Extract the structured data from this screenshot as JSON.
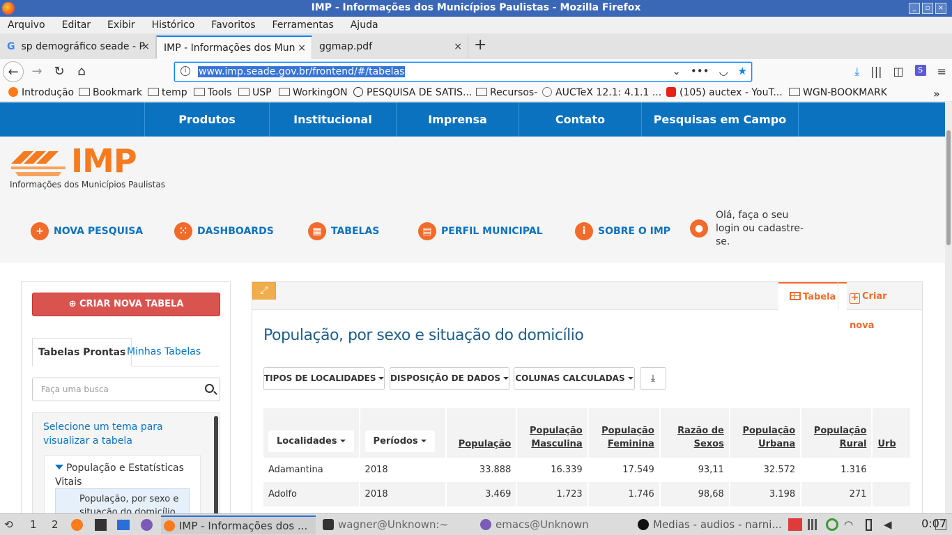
{
  "window": {
    "title": "IMP - Informações dos Municípios Paulistas - Mozilla Firefox",
    "controls": [
      "_",
      "▫",
      "×"
    ]
  },
  "menu": [
    "Arquivo",
    "Editar",
    "Exibir",
    "Histórico",
    "Favoritos",
    "Ferramentas",
    "Ajuda"
  ],
  "tabs": [
    {
      "label": "sp demográfico seade - P",
      "close": "×"
    },
    {
      "label": "IMP - Informações dos Munic",
      "close": "×"
    },
    {
      "label": "ggmap.pdf",
      "close": "×"
    }
  ],
  "newtab_label": "+",
  "nav": {
    "url": "www.imp.seade.gov.br/frontend/#/tabelas",
    "back": "←",
    "forward": "→",
    "reload": "↻",
    "home": "⌂",
    "url_icons": {
      "dropdown": "⌄",
      "more": "•••",
      "pocket": "◡",
      "star": "★"
    },
    "right_icons": {
      "download": "⤓",
      "library": "|||",
      "sidebar": "◫",
      "ext": "S",
      "menu": "≡"
    }
  },
  "bookmarks": [
    {
      "label": "Introdução",
      "type": "firefox"
    },
    {
      "label": "Bookmark",
      "type": "folder"
    },
    {
      "label": "temp",
      "type": "folder"
    },
    {
      "label": "Tools",
      "type": "folder"
    },
    {
      "label": "USP",
      "type": "folder"
    },
    {
      "label": "WorkingON",
      "type": "folder"
    },
    {
      "label": "PESQUISA DE SATIS...",
      "type": "globe"
    },
    {
      "label": "Recursos-",
      "type": "folder"
    },
    {
      "label": "AUCTeX 12.1: 4.1.1 ...",
      "type": "gnu"
    },
    {
      "label": "(105) auctex - YouT...",
      "type": "youtube"
    },
    {
      "label": "WGN-BOOKMARK",
      "type": "folder"
    }
  ],
  "bookmarks_more": "»",
  "site_nav": [
    "Produtos",
    "Institucional",
    "Imprensa",
    "Contato",
    "Pesquisas em Campo"
  ],
  "logo": {
    "text": "IMP",
    "subtitle": "Informações dos Municípios Paulistas"
  },
  "main_nav": [
    {
      "label": "NOVA PESQUISA",
      "icon": "+"
    },
    {
      "label": "DASHBOARDS",
      "icon": "⁙"
    },
    {
      "label": "TABELAS",
      "icon": "▦"
    },
    {
      "label": "PERFIL MUNICIPAL",
      "icon": "▤"
    },
    {
      "label": "SOBRE O IMP",
      "icon": "i"
    }
  ],
  "login": {
    "label": "Olá, faça o seu login ou cadastre-se.",
    "icon": "●"
  },
  "left_panel": {
    "create_button": "CRIAR NOVA TABELA",
    "create_icon": "⊕",
    "tab_ready": "Tabelas Prontas",
    "tab_mine": "Minhas Tabelas",
    "search_placeholder": "Faça uma busca",
    "hint": "Selecione um tema para visualizar a tabela",
    "group_title": "População e Estatísticas Vitais",
    "subitem": "População, por sexo e situação do domicílio"
  },
  "right_panel": {
    "expand_icon": "⤢",
    "tab_table": "Tabela",
    "tab_new": "Criar nova",
    "title": "População, por sexo e situação do domicílio",
    "dropdowns": [
      "TIPOS DE LOCALIDADES",
      "DISPOSIÇÃO DE DADOS",
      "COLUNAS CALCULADAS"
    ],
    "download_icon": "⤓"
  },
  "table": {
    "filter_localidades": "Localidades",
    "filter_periodos": "Períodos",
    "headers": [
      [
        "População"
      ],
      [
        "População",
        "Masculina"
      ],
      [
        "População",
        "Feminina"
      ],
      [
        "Razão de",
        "Sexos"
      ],
      [
        "População",
        "Urbana"
      ],
      [
        "População",
        "Rural"
      ],
      [
        "Urb"
      ]
    ],
    "rows": [
      [
        "Adamantina",
        "2018",
        "33.888",
        "16.339",
        "17.549",
        "93,11",
        "32.572",
        "1.316",
        ""
      ],
      [
        "Adolfo",
        "2018",
        "3.469",
        "1.723",
        "1.746",
        "98,68",
        "3.198",
        "271",
        ""
      ]
    ]
  },
  "taskbar": {
    "workspaces": [
      "1",
      "2"
    ],
    "windows": [
      {
        "label": "IMP - Informações dos ...",
        "color": "#ff7a1a"
      },
      {
        "label": "wagner@Unknown:~",
        "color": "#333333"
      },
      {
        "label": "emacs@Unknown",
        "color": "#7b5bb6"
      },
      {
        "label": "Medias - audios - narni...",
        "color": "#111111"
      }
    ],
    "clock": "0:07"
  }
}
